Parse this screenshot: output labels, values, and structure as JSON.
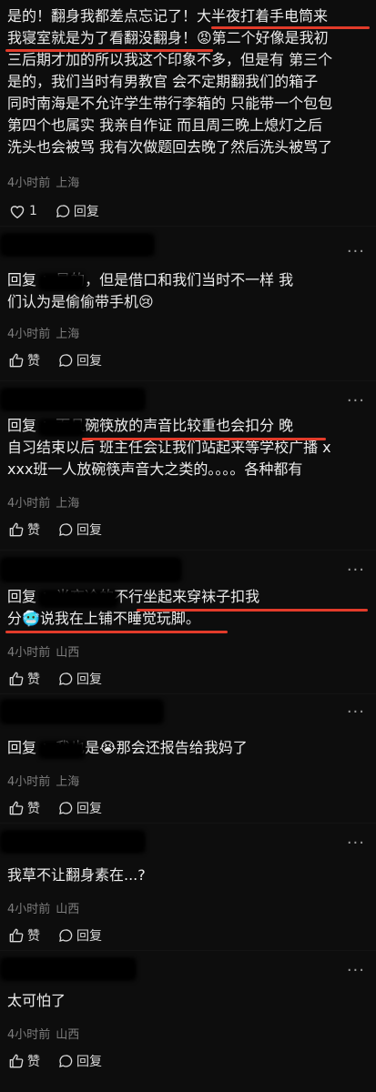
{
  "comments": [
    {
      "lines": [
        "是的！翻身我都差点忘记了！大半夜打着手电筒来",
        "我寝室就是为了看翻没翻身！😡第二个好像是我初",
        "三后期才加的所以我这个印象不多，但是有 第三个",
        "是的，我们当时有男教官 会不定期翻我们的箱子",
        "同时南海是不允许学生带行李箱的 只能带一个包包",
        "第四个也属实 我亲自作证 而且周三晚上熄灯之后",
        "洗头也会被骂 我有次做题回去晚了然后洗头被骂了"
      ],
      "time": "4小时前",
      "location": "上海",
      "like_label": "1",
      "reply_label": "回复"
    },
    {
      "lines": [
        "回复      ：是的，但是借口和我们当时不一样 我",
        "们认为是偷偷带手机😢"
      ],
      "time": "4小时前",
      "location": "上海",
      "like_label": "赞",
      "reply_label": "回复"
    },
    {
      "lines": [
        "回复      ：而且碗筷放的声音比较重也会扣分 晚",
        "自习结束以后 班主任会让我们站起来等学校广播 x",
        "xxx班一人放碗筷声音大之类的。。。。各种都有"
      ],
      "time": "4小时前",
      "location": "上海",
      "like_label": "赞",
      "reply_label": "回复"
    },
    {
      "lines": [
        "回复           ：半夜冷的不行坐起来穿袜子扣我",
        "分🥶说我在上铺不睡觉玩脚。"
      ],
      "time": "4小时前",
      "location": "山西",
      "like_label": "赞",
      "reply_label": "回复"
    },
    {
      "lines": [
        "回复      ：我也是😭那会还报告给我妈了"
      ],
      "time": "4小时前",
      "location": "上海",
      "like_label": "赞",
      "reply_label": "回复"
    },
    {
      "lines": [
        "我草不让翻身素在...?"
      ],
      "time": "4小时前",
      "location": "山西",
      "like_label": "赞",
      "reply_label": "回复"
    },
    {
      "lines": [
        "太可怕了"
      ],
      "time": "4小时前",
      "location": "山西",
      "like_label": "赞",
      "reply_label": "回复"
    }
  ],
  "more_label": "···",
  "colors": {
    "background": "#0d0d0d",
    "text": "#ececec",
    "meta": "#7d7d7d",
    "underline": "#e23b2a"
  }
}
